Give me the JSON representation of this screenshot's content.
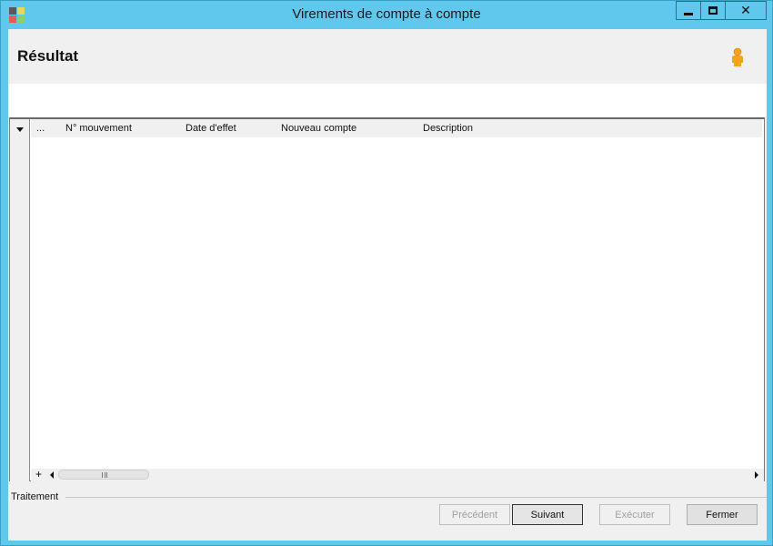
{
  "window": {
    "title": "Virements de compte à compte",
    "minimize_label": "",
    "maximize_label": "",
    "close_label": "✕"
  },
  "header": {
    "title": "Résultat"
  },
  "grid": {
    "selector_label": "...",
    "columns": [
      "N° mouvement",
      "Date d'effet",
      "Nouveau compte",
      "Description"
    ],
    "rows": [],
    "add_row_label": "+"
  },
  "group": {
    "label": "Traitement"
  },
  "buttons": {
    "previous": "Précédent",
    "next": "Suivant",
    "execute": "Exécuter",
    "close": "Fermer"
  }
}
